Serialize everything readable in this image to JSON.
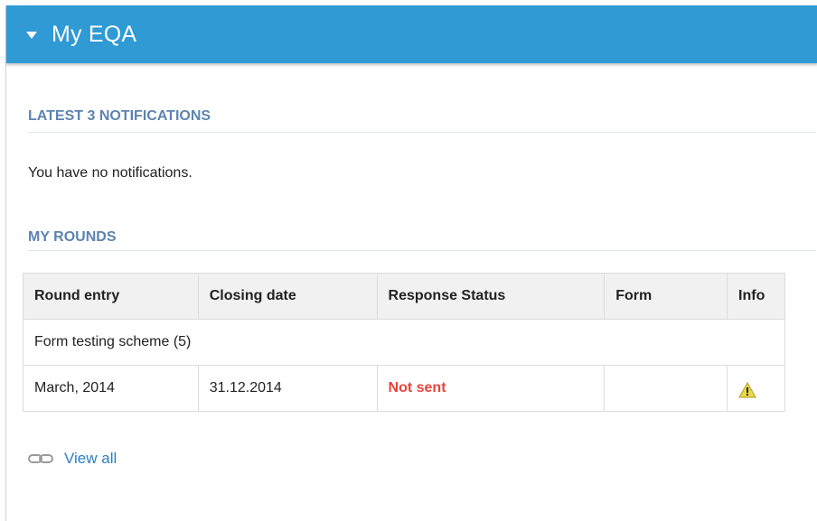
{
  "header": {
    "title": "My EQA"
  },
  "notifications": {
    "heading": "LATEST 3 NOTIFICATIONS",
    "empty_text": "You have no notifications."
  },
  "rounds": {
    "heading": "MY ROUNDS",
    "columns": [
      "Round entry",
      "Closing date",
      "Response Status",
      "Form",
      "Info"
    ],
    "group_label": "Form testing scheme (5)",
    "rows": [
      {
        "round_entry": "March, 2014",
        "closing_date": "31.12.2014",
        "response_status": "Not sent",
        "form": "",
        "info_icon": "warning-icon"
      }
    ]
  },
  "footer": {
    "view_all_label": "View all",
    "icon": "link-icon"
  },
  "colors": {
    "header_bg": "#2f9ad3",
    "section_heading": "#5d84b0",
    "status_not_sent": "#e9443a",
    "link": "#2a7fc4"
  }
}
